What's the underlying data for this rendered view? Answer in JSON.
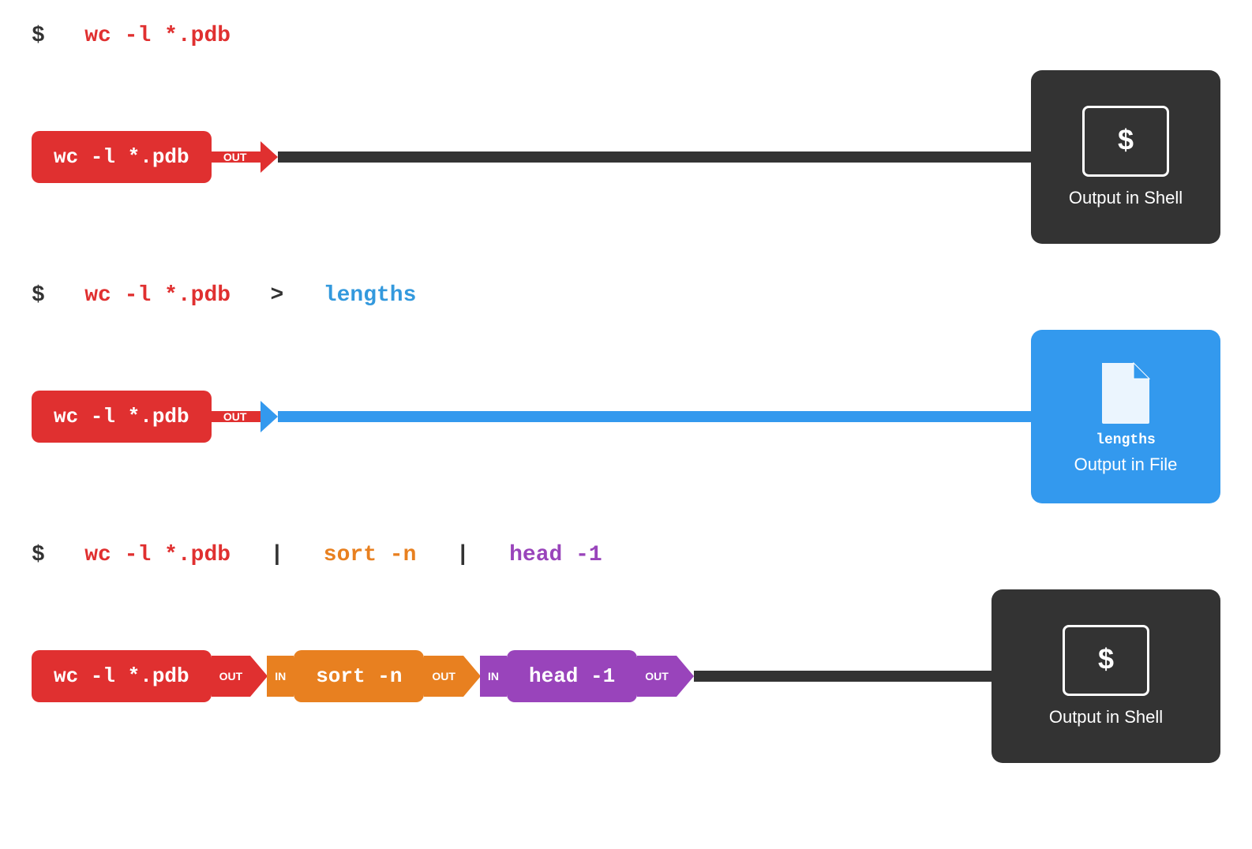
{
  "section1": {
    "command_dollar": "$",
    "command_text": "wc -l *.pdb",
    "pill_text": "wc -l *.pdb",
    "out_label": "OUT",
    "shell_dollar": "$",
    "shell_label": "Output in Shell"
  },
  "section2": {
    "command_dollar": "$",
    "command_text_red": "wc -l *.pdb",
    "command_gt": ">",
    "command_text_blue": "lengths",
    "pill_text": "wc -l *.pdb",
    "out_label": "OUT",
    "file_filename": "lengths",
    "file_label": "Output in File"
  },
  "section3": {
    "command_dollar": "$",
    "command_text_red": "wc -l *.pdb",
    "command_pipe1": "|",
    "command_text_orange": "sort -n",
    "command_pipe2": "|",
    "command_text_purple": "head -1",
    "pill1_text": "wc -l *.pdb",
    "out_label": "OUT",
    "in_label": "IN",
    "pill2_text": "sort -n",
    "pill3_text": "head -1",
    "shell_dollar": "$",
    "shell_label": "Output in Shell"
  }
}
